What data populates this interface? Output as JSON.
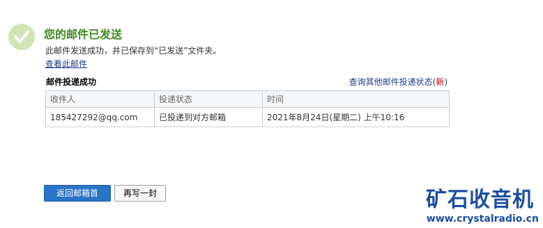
{
  "header": {
    "title": "您的邮件已发送",
    "description": "此邮件发送成功，并已保存到“已发送”文件夹。",
    "view_link": "查看此邮件"
  },
  "delivery": {
    "section_title": "邮件投递成功",
    "query_link": "查询其他邮件投递状态",
    "query_link_new_open": "(",
    "query_link_new": "新",
    "query_link_new_close": ")",
    "columns": [
      "收件人",
      "投递状态",
      "时间"
    ],
    "rows": [
      [
        "185427292@qq.com",
        "已投递到对方邮箱",
        "2021年8月24日(星期二) 上午10:16"
      ]
    ]
  },
  "actions": {
    "back_label": "返回邮箱首页",
    "rewrite_label": "再写一封"
  },
  "watermark": {
    "title": "矿石收音机",
    "url": "www.crystalradio.cn"
  },
  "colors": {
    "title_green": "#3f8a1e",
    "link_blue": "#1d3c8c",
    "new_red": "#c00000",
    "primary_button": "#2a74c6",
    "watermark_blue": "#1c4ea1"
  },
  "icons": {
    "success": "check-circle-icon"
  }
}
